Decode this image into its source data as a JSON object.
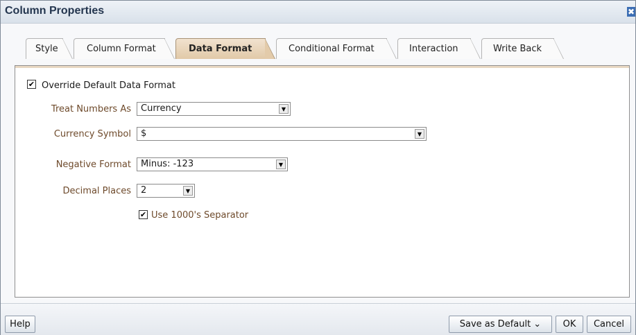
{
  "dialog": {
    "title": "Column Properties",
    "close_glyph": "✖"
  },
  "tabs": [
    {
      "label": "Style"
    },
    {
      "label": "Column Format"
    },
    {
      "label": "Data Format",
      "active": true
    },
    {
      "label": "Conditional Format"
    },
    {
      "label": "Interaction"
    },
    {
      "label": "Write Back"
    }
  ],
  "form": {
    "override_label": "Override Default Data Format",
    "override_checked": true,
    "treat_numbers_as": {
      "label": "Treat Numbers As",
      "value": "Currency"
    },
    "currency_symbol": {
      "label": "Currency Symbol",
      "value": "$"
    },
    "negative_format": {
      "label": "Negative Format",
      "value": "Minus: -123"
    },
    "decimal_places": {
      "label": "Decimal Places",
      "value": "2"
    },
    "separator_label": "Use 1000's Separator",
    "separator_checked": true
  },
  "glyphs": {
    "check": "✔",
    "dropdown": "▼"
  },
  "footer": {
    "help_label": "Help",
    "save_default_label": "Save as Default ⌄",
    "ok_label": "OK",
    "cancel_label": "Cancel"
  },
  "colors": {
    "label_brown": "#6e4a2b",
    "active_tab": "#e1c9a8",
    "title_text": "#24364f"
  }
}
